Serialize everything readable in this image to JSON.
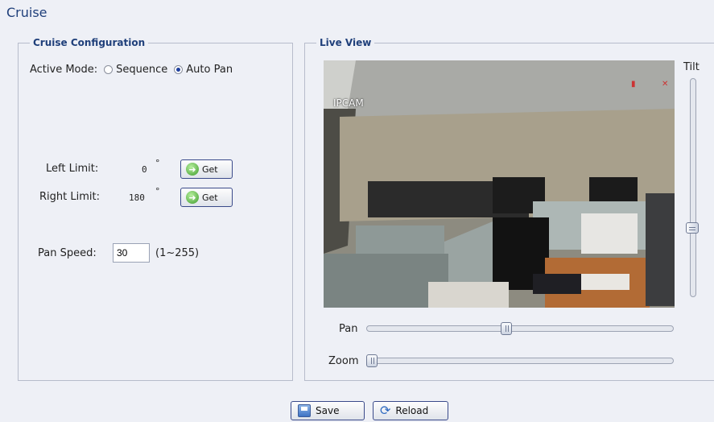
{
  "page": {
    "title": "Cruise"
  },
  "config": {
    "legend": "Cruise Configuration",
    "active_mode_label": "Active Mode:",
    "mode_options": [
      "Sequence",
      "Auto Pan"
    ],
    "selected_mode": "Auto Pan",
    "left_limit_label": "Left Limit:",
    "left_limit_value": "0",
    "right_limit_label": "Right Limit:",
    "right_limit_value": "180",
    "degree_symbol": "°",
    "get_label": "Get",
    "pan_speed_label": "Pan Speed:",
    "pan_speed_value": "30",
    "pan_speed_range": "(1~255)"
  },
  "live": {
    "legend": "Live View",
    "camera_overlay": "IPCAM",
    "tilt_label": "Tilt",
    "pan_label": "Pan",
    "zoom_label": "Zoom",
    "pan_level": 0.45,
    "zoom_level": 0.0,
    "tilt_level": 0.72
  },
  "footer": {
    "save_label": "Save",
    "reload_label": "Reload"
  },
  "icons": [
    "arrow-right-icon",
    "save-icon",
    "reload-icon"
  ],
  "colors": {
    "accent": "#1f3f7a",
    "background": "#eef0f6"
  }
}
